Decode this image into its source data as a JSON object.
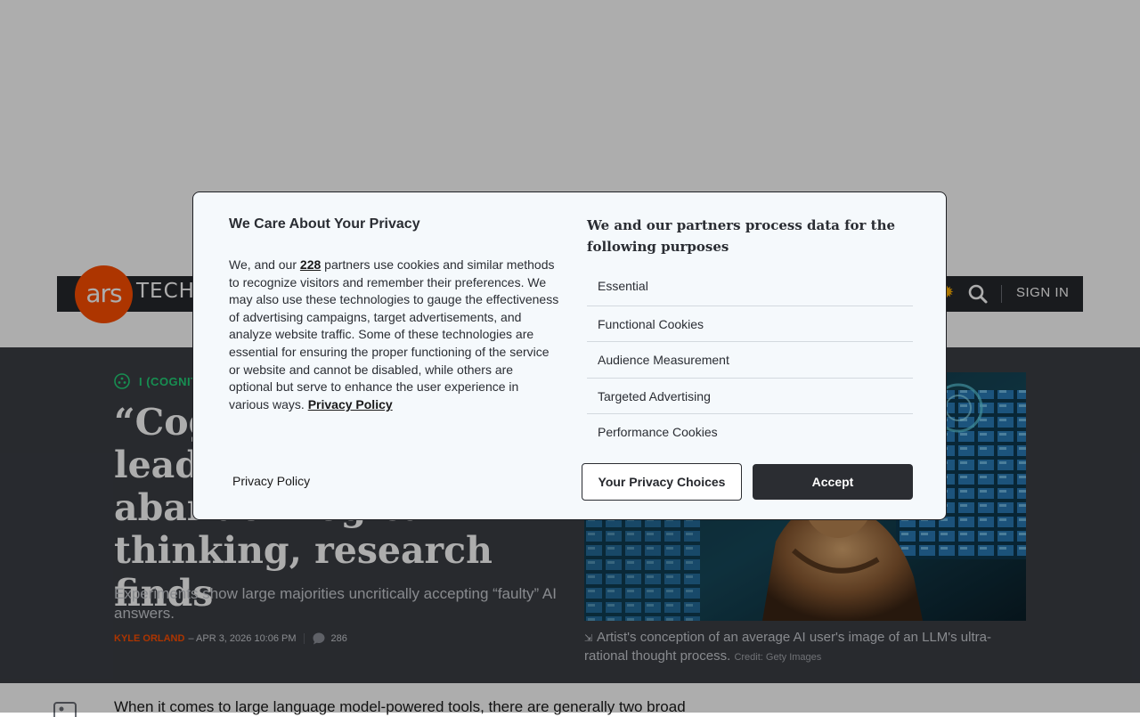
{
  "brand": {
    "logo_ars": "ars",
    "logo_tech": "TECH",
    "accent": "#ff4e00"
  },
  "nav": {
    "sign_in": "SIGN IN"
  },
  "article": {
    "category": "I (COGNIT",
    "headline": "“Cognitive surrender” leads AI users to abandon logical thinking, research finds",
    "subhead": "Experiments show large majorities uncritically accepting “faulty” AI answers.",
    "author": "KYLE ORLAND",
    "date": "– APR 3, 2026 10:06 PM",
    "comment_count": "286",
    "caption": "Artist's conception of an average AI user's image of an LLM's ultra-rational thought process.",
    "caption_credit": "Credit: Gety Images",
    "body_first_line": "When it comes to large language model-powered tools, there are generally two broad"
  },
  "consent": {
    "title": "We Care About Your Privacy",
    "body_before": "We, and our ",
    "partners_count": "228",
    "body_after": " partners use cookies and similar methods to recognize visitors and remember their preferences. We may also use these technologies to gauge the effectiveness of advertising campaigns, target advertisements, and analyze website traffic. Some of these technologies are essential for ensuring the proper functioning of the service or website and cannot be disabled, while others are optional but serve to enhance the user experience in various ways. ",
    "privacy_policy_link": "Privacy Policy",
    "purposes_title": "We and our partners process data for the following purposes",
    "purposes": [
      "Essential",
      "Functional Cookies",
      "Audience Measurement",
      "Targeted Advertising",
      "Performance Cookies"
    ],
    "footer_privacy_policy": "Privacy Policy",
    "choices_button": "Your Privacy Choices",
    "accept_button": "Accept"
  }
}
